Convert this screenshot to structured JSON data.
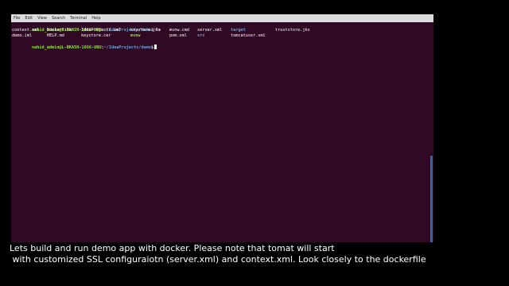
{
  "menu": {
    "items": [
      "File",
      "Edit",
      "View",
      "Search",
      "Terminal",
      "Help"
    ]
  },
  "terminal": {
    "prompt": {
      "user_host": "nahid_admin@L-BKASH-1866-UBU",
      "separator": ":",
      "path": "~/IdeaProjects/demo",
      "dollar": "$"
    },
    "command": "ls",
    "listing": {
      "row1": [
        {
          "name": "context.xml",
          "kind": "plain"
        },
        {
          "name": "Dockerfile",
          "kind": "plain"
        },
        {
          "name": "IdeaProjects.iml",
          "kind": "plain"
        },
        {
          "name": "keystore.jks",
          "kind": "plain"
        },
        {
          "name": "mvnw.cmd",
          "kind": "plain"
        },
        {
          "name": "server.xml",
          "kind": "plain"
        },
        {
          "name": "target",
          "kind": "dir"
        },
        {
          "name": "truststore.jks",
          "kind": "plain"
        }
      ],
      "row2": [
        {
          "name": "demo.iml",
          "kind": "plain"
        },
        {
          "name": "HELP.md",
          "kind": "plain"
        },
        {
          "name": "keystore.cer",
          "kind": "plain"
        },
        {
          "name": "mvnw",
          "kind": "exec"
        },
        {
          "name": "pom.xml",
          "kind": "plain"
        },
        {
          "name": "src",
          "kind": "dir"
        },
        {
          "name": "tomcatuser.xml",
          "kind": "plain"
        }
      ]
    }
  },
  "caption": {
    "line1": "Lets build and run demo app with docker. Please note that tomat will start",
    "line2": " with customized SSL configuraiotn (server.xml) and context.xml. Look closely to the dockerfile"
  },
  "colors": {
    "terminal_bg": "#300a24",
    "prompt_user": "#8ae234",
    "prompt_path": "#729fcf",
    "directory": "#729fcf",
    "executable": "#8ae234",
    "scrollbar": "#3465a4"
  }
}
